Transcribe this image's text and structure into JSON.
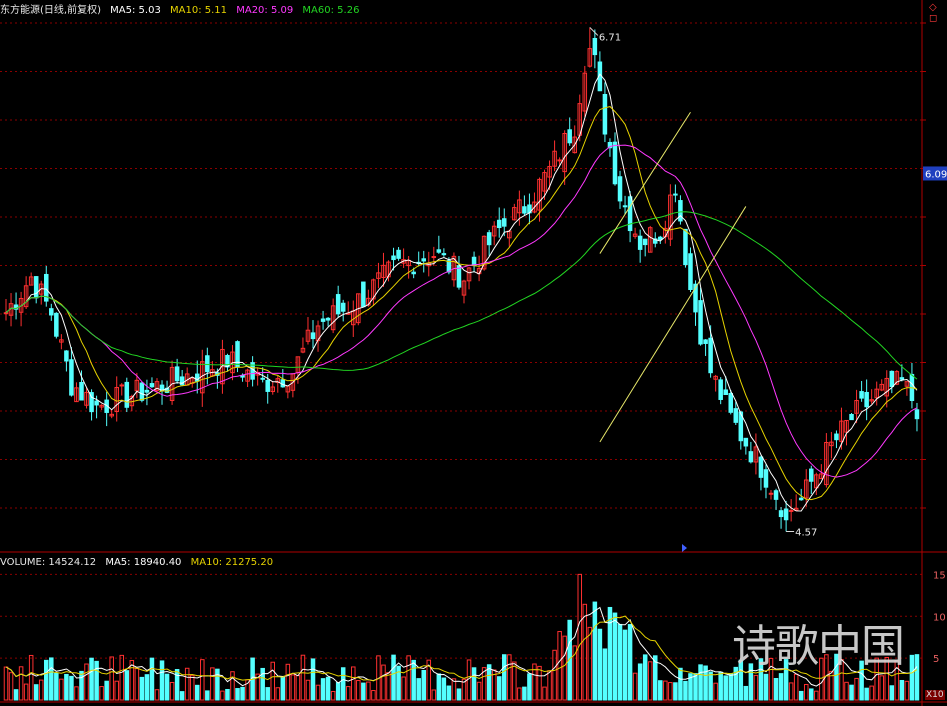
{
  "header": {
    "security": "东方能源(日线,前复权)",
    "ma5": "MA5: 5.03",
    "ma10": "MA10: 5.11",
    "ma20": "MA20: 5.09",
    "ma60": "MA60: 5.26"
  },
  "volume_header": {
    "volume": "VOLUME: 14524.12",
    "ma5": "MA5: 18940.40",
    "ma10": "MA10: 21275.20"
  },
  "price_panel": {
    "last_price_tag": "6.09",
    "high_label": "6.71",
    "low_label": "4.57"
  },
  "volume_panel": {
    "unit_label": "X10",
    "axis_labels": [
      "15",
      "10",
      "5"
    ]
  },
  "watermark": "诗歌中国",
  "colors": {
    "up": "#ff3030",
    "down": "#54ffff",
    "ma5": "#ffffff",
    "ma10": "#e6d300",
    "ma20": "#ff39ff",
    "ma60": "#22d422",
    "grid": "#8a0000",
    "trendline": "#e8e86a"
  },
  "chart_data": {
    "type": "candlestick",
    "y_range": [
      4.5,
      6.75
    ],
    "volume_range": [
      0,
      16
    ],
    "high_annotation": 6.71,
    "low_annotation": 4.57,
    "series_names": [
      "MA5",
      "MA10",
      "MA20",
      "MA60",
      "VOLUME"
    ],
    "waypoints": [
      [
        0,
        5.5
      ],
      [
        5,
        5.65
      ],
      [
        9,
        5.5
      ],
      [
        13,
        5.2
      ],
      [
        18,
        5.1
      ],
      [
        25,
        5.15
      ],
      [
        32,
        5.2
      ],
      [
        38,
        5.25
      ],
      [
        44,
        5.3
      ],
      [
        51,
        5.2
      ],
      [
        57,
        5.25
      ],
      [
        62,
        5.45
      ],
      [
        70,
        5.55
      ],
      [
        78,
        5.7
      ],
      [
        85,
        5.75
      ],
      [
        91,
        5.65
      ],
      [
        98,
        5.85
      ],
      [
        103,
        5.95
      ],
      [
        108,
        6.1
      ],
      [
        113,
        6.3
      ],
      [
        116,
        6.71
      ],
      [
        118,
        6.4
      ],
      [
        122,
        6.0
      ],
      [
        126,
        5.8
      ],
      [
        130,
        5.85
      ],
      [
        133,
        6.05
      ],
      [
        136,
        5.6
      ],
      [
        140,
        5.25
      ],
      [
        144,
        5.05
      ],
      [
        150,
        4.85
      ],
      [
        155,
        4.65
      ],
      [
        158,
        4.7
      ],
      [
        163,
        4.9
      ],
      [
        168,
        5.05
      ],
      [
        173,
        5.15
      ],
      [
        178,
        5.2
      ],
      [
        181,
        5.1
      ]
    ]
  }
}
